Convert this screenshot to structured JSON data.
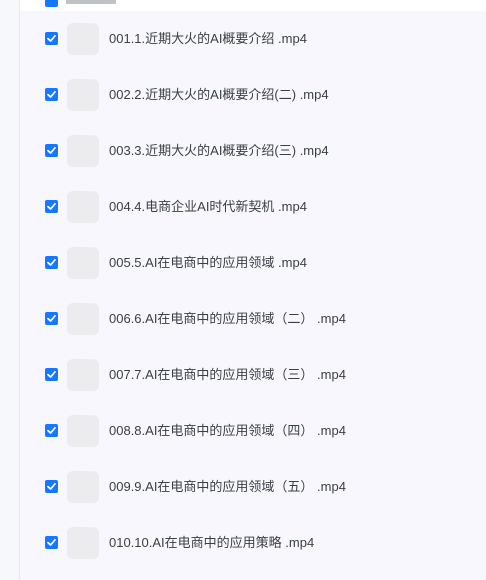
{
  "files": [
    {
      "name": "001.1.近期大火的AI概要介绍 .mp4",
      "checked": true,
      "icon": "file-thumbnail-icon"
    },
    {
      "name": "002.2.近期大火的AI概要介绍(二) .mp4",
      "checked": true,
      "icon": "file-thumbnail-icon"
    },
    {
      "name": "003.3.近期大火的AI概要介绍(三) .mp4",
      "checked": true,
      "icon": "file-thumbnail-icon"
    },
    {
      "name": "004.4.电商企业AI时代新契机 .mp4",
      "checked": true,
      "icon": "file-thumbnail-icon"
    },
    {
      "name": "005.5.AI在电商中的应用领域 .mp4",
      "checked": true,
      "icon": "file-thumbnail-icon"
    },
    {
      "name": "006.6.AI在电商中的应用领域（二） .mp4",
      "checked": true,
      "icon": "file-thumbnail-icon"
    },
    {
      "name": "007.7.AI在电商中的应用领域（三） .mp4",
      "checked": true,
      "icon": "file-thumbnail-icon"
    },
    {
      "name": "008.8.AI在电商中的应用领域（四） .mp4",
      "checked": true,
      "icon": "file-thumbnail-icon"
    },
    {
      "name": "009.9.AI在电商中的应用领域（五） .mp4",
      "checked": true,
      "icon": "file-thumbnail-icon"
    },
    {
      "name": "010.10.AI在电商中的应用策略 .mp4",
      "checked": true,
      "icon": "file-thumbnail-icon"
    }
  ],
  "colors": {
    "accent": "#1677ff",
    "text": "#3a3f47",
    "thumbnail": "#ececee",
    "panel": "#f7f7fd"
  }
}
